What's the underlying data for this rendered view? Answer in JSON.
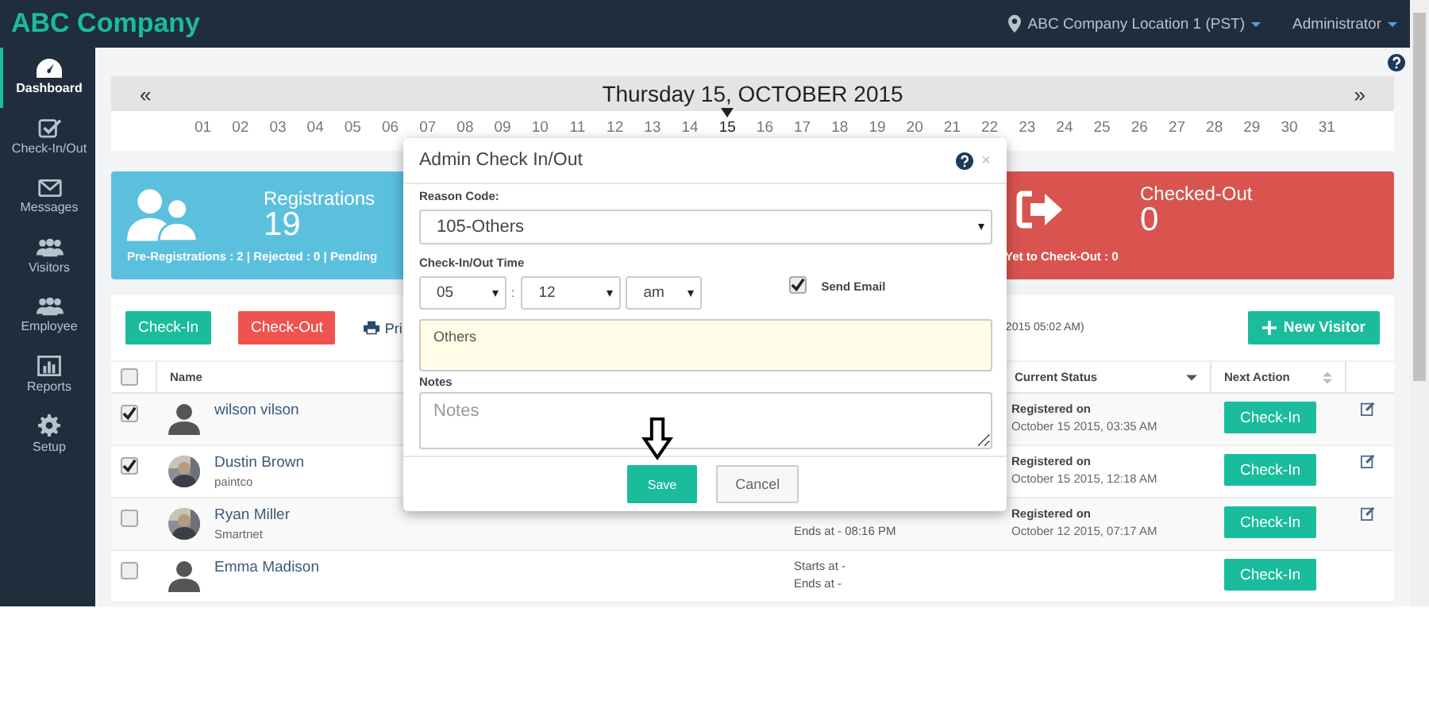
{
  "header": {
    "brand": "ABC Company",
    "location": "ABC Company Location 1 (PST)",
    "user": "Administrator"
  },
  "sidebar": {
    "items": [
      {
        "label": "Dashboard",
        "selected": true
      },
      {
        "label": "Check-In/Out",
        "selected": false
      },
      {
        "label": "Messages",
        "selected": false
      },
      {
        "label": "Visitors",
        "selected": false
      },
      {
        "label": "Employee",
        "selected": false
      },
      {
        "label": "Reports",
        "selected": false
      },
      {
        "label": "Setup",
        "selected": false
      }
    ]
  },
  "date_bar": {
    "prev": "«",
    "title": "Thursday 15, OCTOBER 2015",
    "next": "»",
    "days": [
      {
        "label": "01",
        "selected": false
      },
      {
        "label": "02",
        "selected": false
      },
      {
        "label": "03",
        "selected": false
      },
      {
        "label": "04",
        "selected": false
      },
      {
        "label": "05",
        "selected": false
      },
      {
        "label": "06",
        "selected": false
      },
      {
        "label": "07",
        "selected": false
      },
      {
        "label": "08",
        "selected": false
      },
      {
        "label": "09",
        "selected": false
      },
      {
        "label": "10",
        "selected": false
      },
      {
        "label": "11",
        "selected": false
      },
      {
        "label": "12",
        "selected": false
      },
      {
        "label": "13",
        "selected": false
      },
      {
        "label": "14",
        "selected": false
      },
      {
        "label": "15",
        "selected": true
      },
      {
        "label": "16",
        "selected": false
      },
      {
        "label": "17",
        "selected": false
      },
      {
        "label": "18",
        "selected": false
      },
      {
        "label": "19",
        "selected": false
      },
      {
        "label": "20",
        "selected": false
      },
      {
        "label": "21",
        "selected": false
      },
      {
        "label": "22",
        "selected": false
      },
      {
        "label": "23",
        "selected": false
      },
      {
        "label": "24",
        "selected": false
      },
      {
        "label": "25",
        "selected": false
      },
      {
        "label": "26",
        "selected": false
      },
      {
        "label": "27",
        "selected": false
      },
      {
        "label": "28",
        "selected": false
      },
      {
        "label": "29",
        "selected": false
      },
      {
        "label": "30",
        "selected": false
      },
      {
        "label": "31",
        "selected": false
      }
    ]
  },
  "stats": [
    {
      "kind": "registrations",
      "title": "Registrations",
      "value": "19",
      "detail": "Pre-Registrations : 2 | Rejected : 0 | Pending",
      "color": "#5bc0de"
    },
    {
      "kind": "checked_out",
      "title": "Checked-Out",
      "value": "0",
      "detail": "Yet to Check-Out : 0",
      "color": "#d9534f"
    }
  ],
  "toolbar": {
    "buttons": [
      {
        "label": "Check-In",
        "kind": "checkin"
      },
      {
        "label": "Check-Out",
        "kind": "checkout"
      }
    ],
    "print_link": "Pri",
    "timestamp": "2015 05:02 AM)",
    "new_visitor": "New Visitor"
  },
  "table": {
    "all_checked": false,
    "columns": [
      {
        "label": "Name"
      },
      {
        "label": "Current Status"
      },
      {
        "label": "Next Action"
      }
    ],
    "rows": [
      {
        "checked": true,
        "photo": false,
        "name": "wilson vilson",
        "schedule": [],
        "status_label": "Registered on",
        "status_date": "October 15 2015, 03:35 AM",
        "action": "Check-In",
        "editable": true
      },
      {
        "checked": true,
        "photo": true,
        "name": "Dustin Brown",
        "company": "paintco",
        "schedule": [],
        "status_label": "Registered on",
        "status_date": "October 15 2015, 12:18 AM",
        "action": "Check-In",
        "editable": true
      },
      {
        "checked": false,
        "photo": true,
        "name": "Ryan Miller",
        "company": "Smartnet",
        "schedule": [
          "Ends at - 08:16 PM"
        ],
        "status_label": "Registered on",
        "status_date": "October 12 2015, 07:17 AM",
        "action": "Check-In",
        "editable": true
      },
      {
        "checked": false,
        "photo": false,
        "name": "Emma Madison",
        "schedule": [
          "Starts at -",
          "Ends at -"
        ],
        "action": "Check-In",
        "editable": false
      }
    ]
  },
  "modal": {
    "title": "Admin Check In/Out",
    "reason_label": "Reason Code:",
    "reason_value": "105-Others",
    "time_label": "Check-In/Out Time",
    "hour": "05",
    "time_separator": ":",
    "minute": "12",
    "ampm": "am",
    "send_email": {
      "label": "Send Email",
      "checked": true
    },
    "reason_text": "Others",
    "notes_label": "Notes",
    "notes_placeholder": "Notes",
    "save": "Save",
    "cancel": "Cancel",
    "close": "×"
  }
}
